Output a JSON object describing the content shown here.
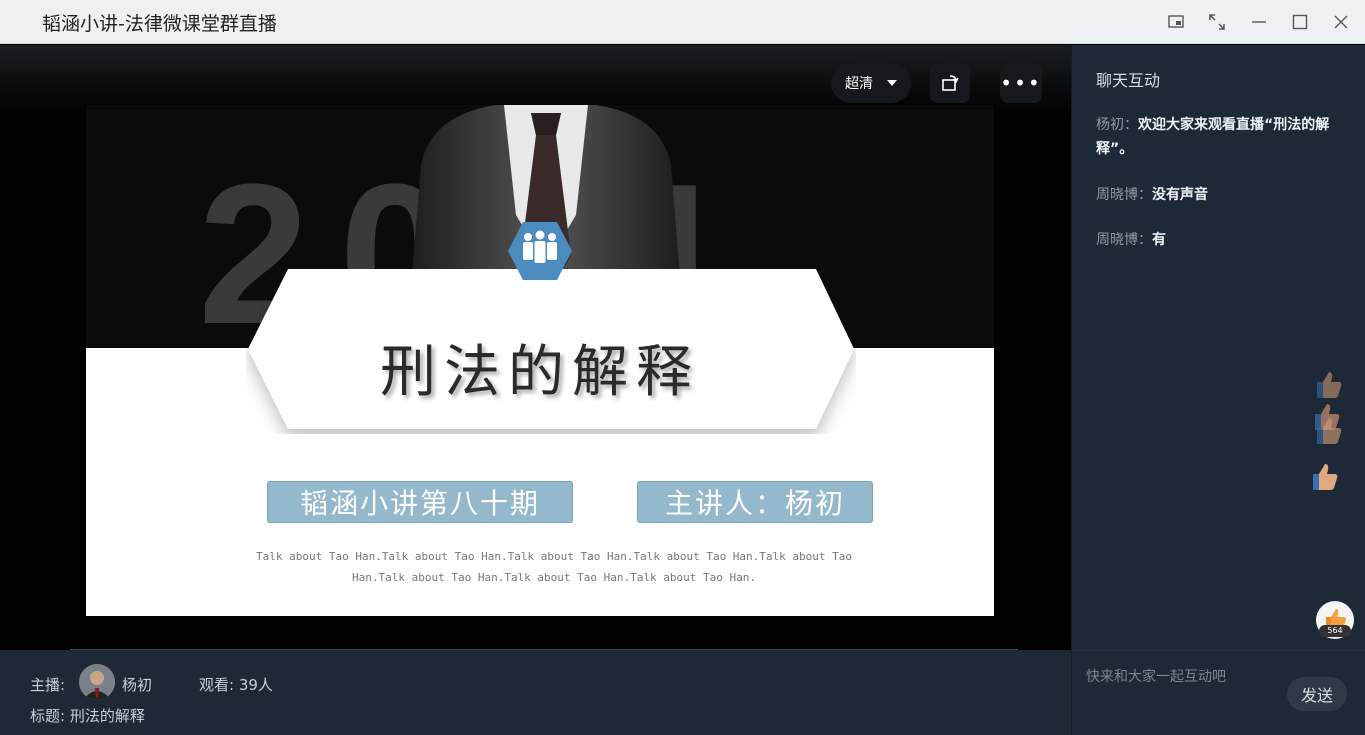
{
  "window": {
    "title": "韬涵小讲-法律微课堂群直播",
    "buttons": [
      "pip-icon",
      "fullscreen-icon",
      "minimize-icon",
      "maximize-icon",
      "close-icon"
    ]
  },
  "player": {
    "quality_label": "超清",
    "more_label": "•••"
  },
  "slide": {
    "year": "2021",
    "title": "刑法的解释",
    "session_label": "韬涵小讲第八十期",
    "speaker_label": "主讲人：杨初",
    "talk_text": "Talk about Tao Han.Talk about Tao Han.Talk about Tao Han.Talk about Tao Han.Talk about Tao Han.Talk about Tao Han.Talk about Tao Han.Talk about Tao Han."
  },
  "info": {
    "host_label": "主播:",
    "host_name": "杨初",
    "viewers": "观看: 39人",
    "topic": "标题: 刑法的解释"
  },
  "chat": {
    "title": "聊天互动",
    "messages": [
      {
        "who": "杨初：",
        "text": "欢迎大家来观看直播“刑法的解释”。"
      },
      {
        "who": "周晓博：",
        "text": "没有声音"
      },
      {
        "who": "周晓博：",
        "text": "有"
      }
    ],
    "like_count": "564",
    "input_placeholder": "快来和大家一起互动吧",
    "send_label": "发送"
  },
  "colors": {
    "panel_bg": "#1e2937",
    "pill_bg": "#94b8cc",
    "badge_blue": "#4a8cc0"
  }
}
